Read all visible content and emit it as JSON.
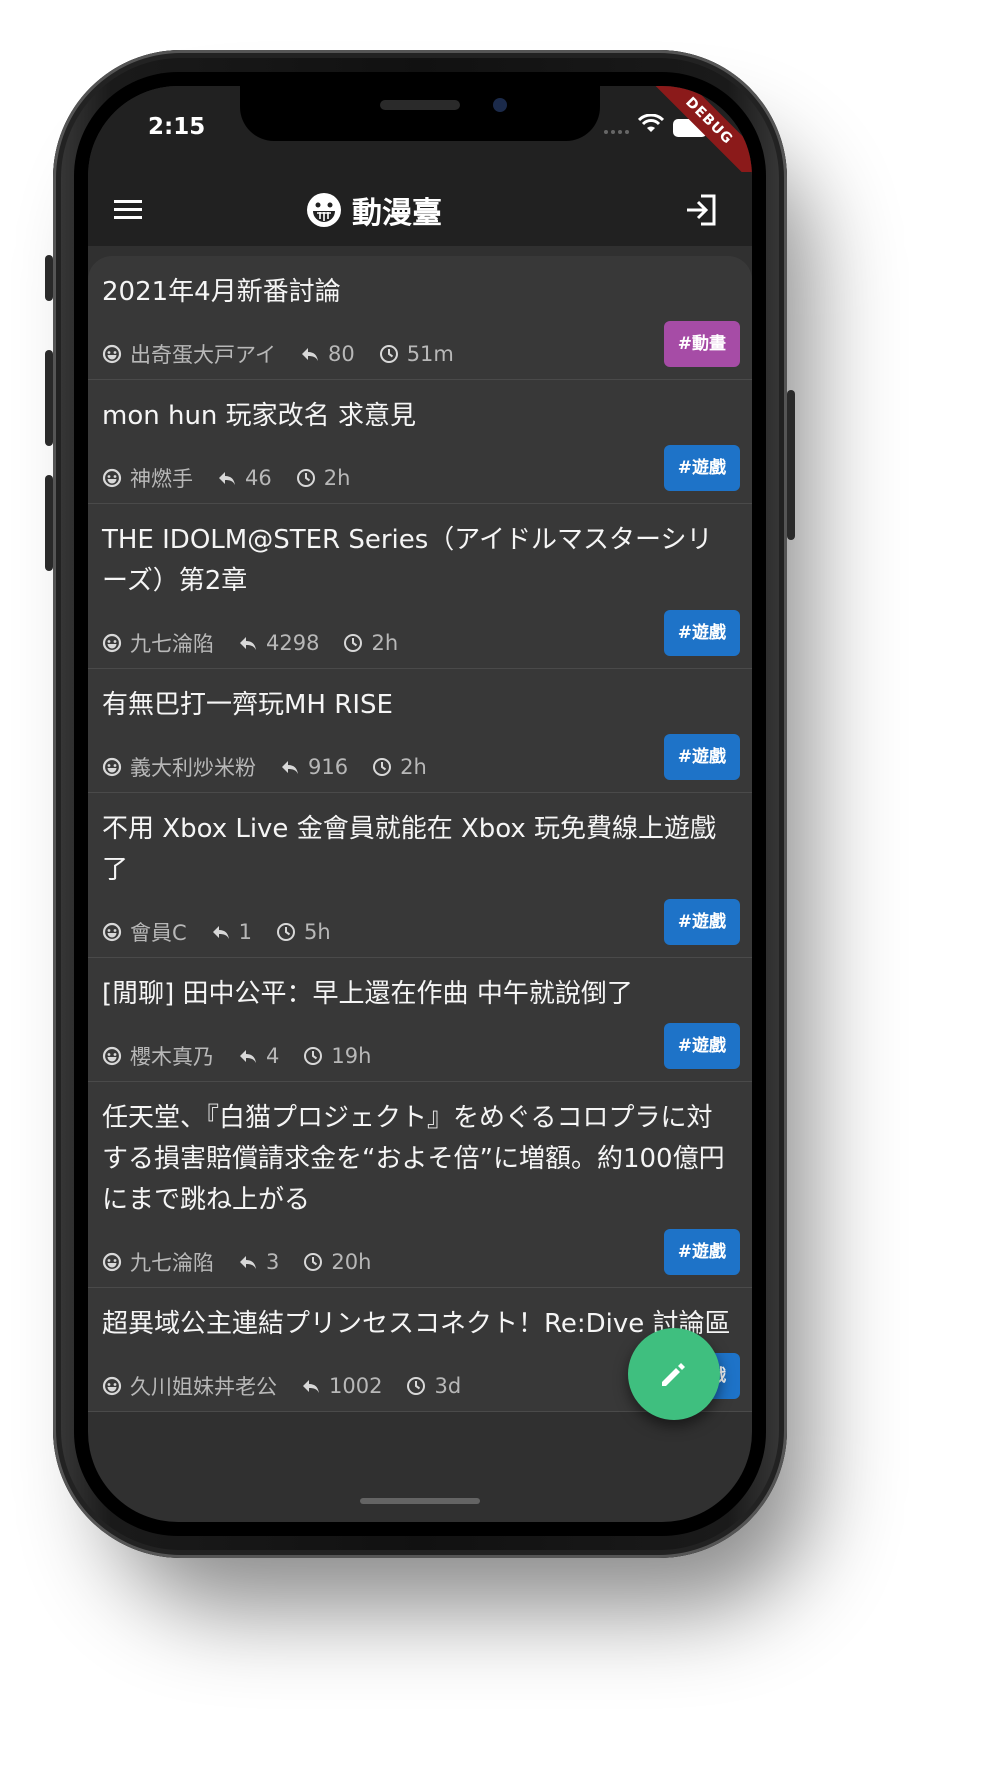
{
  "status_bar": {
    "time": "2:15",
    "debug_label": "DEBUG"
  },
  "app_bar": {
    "title": "動漫臺",
    "logo_icon": "grin-face-icon",
    "menu_icon": "hamburger-menu-icon",
    "login_icon": "login-icon"
  },
  "colors": {
    "tag_animation": "#a64ca6",
    "tag_game": "#1e73c8",
    "fab": "#3fbf7f",
    "background": "#383838",
    "appbar": "#212121"
  },
  "threads": [
    {
      "title": "2021年4月新番討論",
      "author": "出奇蛋大戸アイ",
      "replies": "80",
      "time": "51m",
      "tag": "#動畫",
      "tag_color": "#a64ca6"
    },
    {
      "title": "mon hun 玩家改名 求意見",
      "author": "神燃手",
      "replies": "46",
      "time": "2h",
      "tag": "#遊戲",
      "tag_color": "#1e73c8"
    },
    {
      "title": "THE IDOLM@STER Series（アイドルマスターシリーズ）第2章",
      "author": "九七淪陷",
      "replies": "4298",
      "time": "2h",
      "tag": "#遊戲",
      "tag_color": "#1e73c8"
    },
    {
      "title": "有無巴打一齊玩MH RISE",
      "author": "義大利炒米粉",
      "replies": "916",
      "time": "2h",
      "tag": "#遊戲",
      "tag_color": "#1e73c8"
    },
    {
      "title": "不用 Xbox Live 金會員就能在 Xbox 玩免費線上遊戲了",
      "author": "會員C",
      "replies": "1",
      "time": "5h",
      "tag": "#遊戲",
      "tag_color": "#1e73c8"
    },
    {
      "title": "[閒聊] 田中公平：早上還在作曲 中午就說倒了",
      "author": "櫻木真乃",
      "replies": "4",
      "time": "19h",
      "tag": "#遊戲",
      "tag_color": "#1e73c8"
    },
    {
      "title": "任天堂、『白猫プロジェクト』をめぐるコロプラに対する損害賠償請求金を“およそ倍”に増額。約100億円にまで跳ね上がる",
      "author": "九七淪陷",
      "replies": "3",
      "time": "20h",
      "tag": "#遊戲",
      "tag_color": "#1e73c8"
    },
    {
      "title": "超異域公主連結プリンセスコネクト！Re:Dive 討論區",
      "author": "久川姐妹丼老公",
      "replies": "1002",
      "time": "3d",
      "tag": "#遊戲",
      "tag_color": "#1e73c8"
    }
  ],
  "fab": {
    "icon": "pencil-icon"
  }
}
